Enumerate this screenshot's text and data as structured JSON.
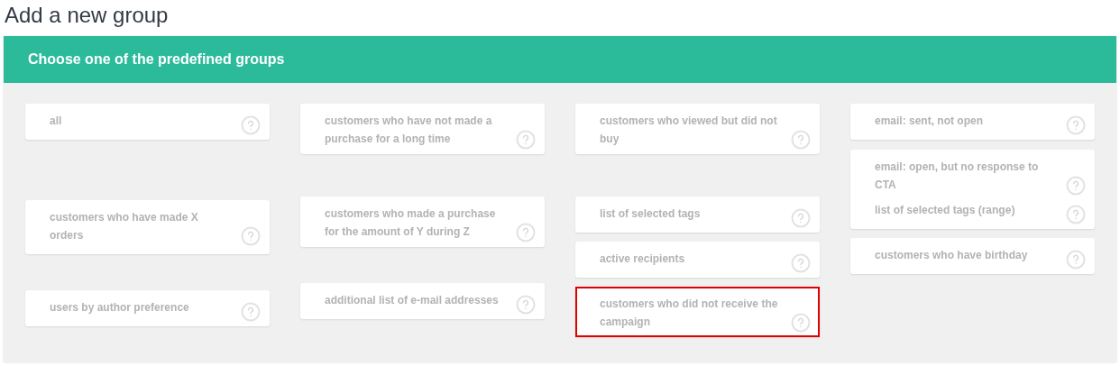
{
  "title": "Add a new group",
  "panel": {
    "heading": "Choose one of the predefined groups",
    "columns": [
      {
        "cards": [
          {
            "labels": [
              "all"
            ],
            "highlighted": false
          },
          {
            "labels": [
              "customers who have made X orders"
            ],
            "highlighted": false
          },
          {
            "labels": [
              "users by author preference"
            ],
            "highlighted": false
          }
        ]
      },
      {
        "cards": [
          {
            "labels": [
              "customers who have not made a purchase for a long time"
            ],
            "highlighted": false
          },
          {
            "labels": [
              "customers who made a purchase for the amount of Y during Z"
            ],
            "highlighted": false
          },
          {
            "labels": [
              "additional list of e-mail addresses"
            ],
            "highlighted": false
          }
        ]
      },
      {
        "cards": [
          {
            "labels": [
              "customers who viewed but did not buy"
            ],
            "highlighted": false
          },
          {
            "labels": [
              "list of selected tags"
            ],
            "highlighted": false
          },
          {
            "labels": [
              "active recipients"
            ],
            "highlighted": false
          },
          {
            "labels": [
              "customers who did not receive the campaign"
            ],
            "highlighted": true
          }
        ]
      },
      {
        "cards": [
          {
            "labels": [
              "email: sent, not open"
            ],
            "highlighted": false
          },
          {
            "labels": [
              "email: open, but no response to CTA",
              "list of selected tags (range)"
            ],
            "highlighted": false
          },
          {
            "labels": [
              "customers who have birthday"
            ],
            "highlighted": false
          }
        ]
      }
    ]
  }
}
